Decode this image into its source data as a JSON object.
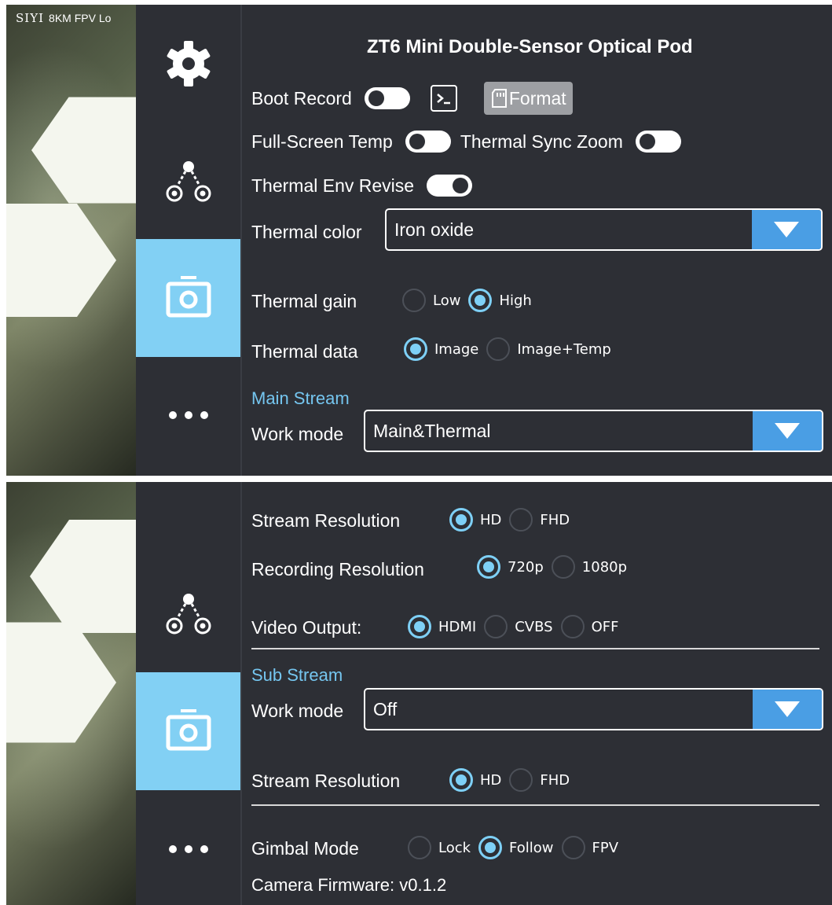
{
  "feed": {
    "brand": "SIYI",
    "title": "8KM FPV Lo"
  },
  "nav": {
    "items": [
      {
        "name": "settings",
        "icon": "gear-icon"
      },
      {
        "name": "link",
        "icon": "link-nodes-icon"
      },
      {
        "name": "camera",
        "icon": "camera-icon",
        "active": true
      },
      {
        "name": "more",
        "icon": "more-dots-icon"
      }
    ]
  },
  "colors": {
    "accent": "#82d0f4",
    "dropdown_button": "#4a9ee4",
    "background": "#2d2f35"
  },
  "screen1": {
    "title": "ZT6 Mini Double-Sensor Optical Pod",
    "boot_record": {
      "label": "Boot Record",
      "on": false
    },
    "format_label": "Format",
    "full_screen_temp": {
      "label": "Full-Screen Temp",
      "on": false
    },
    "thermal_sync_zoom": {
      "label": "Thermal Sync Zoom",
      "on": false
    },
    "thermal_env_revise": {
      "label": "Thermal Env Revise",
      "on": true
    },
    "thermal_color": {
      "label": "Thermal color",
      "value": "Iron oxide"
    },
    "thermal_gain": {
      "label": "Thermal gain",
      "options": [
        "Low",
        "High"
      ],
      "selected": "High"
    },
    "thermal_data": {
      "label": "Thermal data",
      "options": [
        "Image",
        "Image+Temp"
      ],
      "selected": "Image"
    },
    "main_stream": {
      "heading": "Main Stream",
      "work_mode_label": "Work mode",
      "work_mode_value": "Main&Thermal"
    }
  },
  "screen2": {
    "stream_resolution": {
      "label": "Stream Resolution",
      "options": [
        "HD",
        "FHD"
      ],
      "selected": "HD"
    },
    "recording_resolution": {
      "label": "Recording Resolution",
      "options": [
        "720p",
        "1080p"
      ],
      "selected": "720p"
    },
    "video_output": {
      "label": "Video Output:",
      "options": [
        "HDMI",
        "CVBS",
        "OFF"
      ],
      "selected": "HDMI"
    },
    "sub_stream": {
      "heading": "Sub Stream",
      "work_mode_label": "Work mode",
      "work_mode_value": "Off",
      "stream_resolution": {
        "label": "Stream Resolution",
        "options": [
          "HD",
          "FHD"
        ],
        "selected": "HD"
      }
    },
    "gimbal_mode": {
      "label": "Gimbal Mode",
      "options": [
        "Lock",
        "Follow",
        "FPV"
      ],
      "selected": "Follow"
    },
    "camera_firmware": "Camera Firmware: v0.1.2"
  }
}
